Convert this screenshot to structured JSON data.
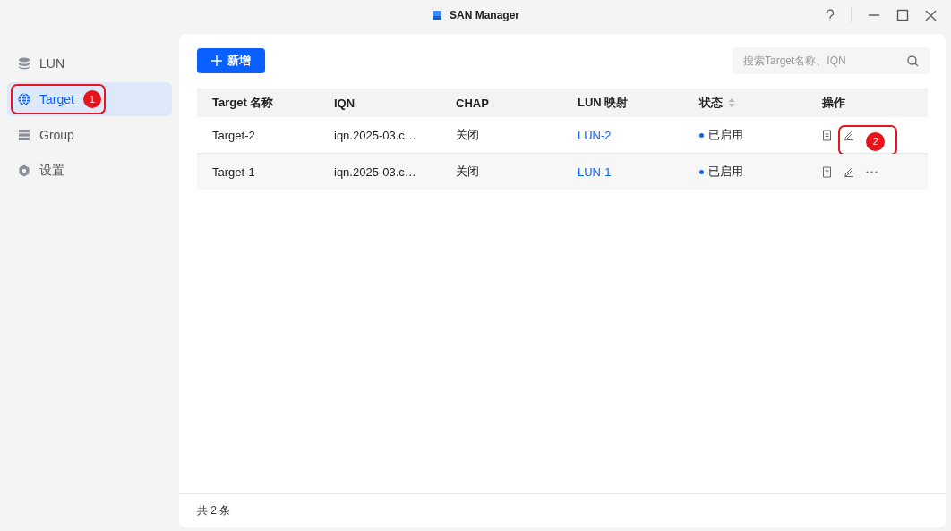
{
  "window": {
    "title": "SAN Manager"
  },
  "sidebar": {
    "items": [
      {
        "label": "LUN",
        "kind": "database",
        "selected": false
      },
      {
        "label": "Target",
        "kind": "globe",
        "selected": true,
        "callout": "1"
      },
      {
        "label": "Group",
        "kind": "list",
        "selected": false
      },
      {
        "label": "设置",
        "kind": "gear",
        "selected": false
      }
    ]
  },
  "toolbar": {
    "add_button": "新增",
    "search": {
      "placeholder": "搜索Target名称、IQN"
    }
  },
  "table": {
    "columns": [
      "Target 名称",
      "IQN",
      "CHAP",
      "LUN 映射",
      "状态",
      "操作"
    ],
    "rows": [
      {
        "name": "Target-2",
        "iqn": "iqn.2025-03.c…",
        "chap": "关闭",
        "lun": "LUN-2",
        "status": "已启用",
        "enabled": true,
        "hovered": false,
        "callout": "2"
      },
      {
        "name": "Target-1",
        "iqn": "iqn.2025-03.c…",
        "chap": "关闭",
        "lun": "LUN-1",
        "status": "已启用",
        "enabled": true,
        "hovered": true
      }
    ]
  },
  "footer": "共 2 条"
}
